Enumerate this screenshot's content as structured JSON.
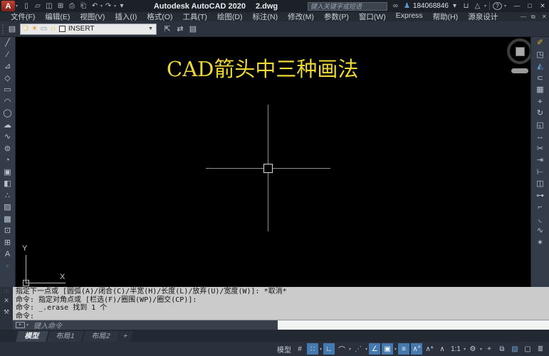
{
  "colors": {
    "accent_blue": "#4679ae",
    "heading_yellow": "#ecd836",
    "logo_red": "#b03a2e",
    "layer_icon_yellow": "#e8c520",
    "canvas_bg": "#000000",
    "command_bg": "#cbcbcb"
  },
  "glyphs": {
    "caret": "▾"
  },
  "title_bar": {
    "logo_letter": "A",
    "app_title": "Autodesk AutoCAD 2020",
    "doc_name": "2.dwg",
    "search_placeholder": "键入关键字或短语",
    "user_id": "184068846",
    "qat_icons": [
      {
        "name": "qnew-icon",
        "glyph": "▯"
      },
      {
        "name": "open-icon",
        "glyph": "▱"
      },
      {
        "name": "save-icon",
        "glyph": "◫"
      },
      {
        "name": "saveas-icon",
        "glyph": "⊞"
      },
      {
        "name": "plot-icon",
        "glyph": "⎙"
      },
      {
        "name": "print-icon",
        "glyph": "⎗"
      },
      {
        "name": "undo-icon",
        "glyph": "↶",
        "caret": true
      },
      {
        "name": "redo-icon",
        "glyph": "↷",
        "caret": true
      },
      {
        "name": "qat-menu-icon",
        "glyph": "▾"
      }
    ],
    "account_icons_left": [
      {
        "name": "search-icon",
        "glyph": "∞"
      },
      {
        "name": "sign-in-icon",
        "glyph": "♟"
      }
    ],
    "account_icons_right": [
      {
        "name": "account-caret-icon",
        "glyph": "▾"
      },
      {
        "name": "app-store-cart-icon",
        "glyph": "⊔"
      },
      {
        "name": "autodesk-app-icon",
        "glyph": "△",
        "caret": true
      }
    ],
    "help_icons": [
      {
        "name": "help-icon",
        "glyph": "?",
        "caret": true
      }
    ],
    "window_controls": [
      {
        "name": "minimize-button",
        "glyph": "—"
      },
      {
        "name": "maximize-button",
        "glyph": "□"
      },
      {
        "name": "close-button",
        "glyph": "✕"
      }
    ]
  },
  "menu_bar": {
    "items": [
      {
        "name": "menu-file",
        "label": "文件(F)"
      },
      {
        "name": "menu-edit",
        "label": "编辑(E)"
      },
      {
        "name": "menu-view",
        "label": "视图(V)"
      },
      {
        "name": "menu-insert",
        "label": "插入(I)"
      },
      {
        "name": "menu-format",
        "label": "格式(O)"
      },
      {
        "name": "menu-tools",
        "label": "工具(T)"
      },
      {
        "name": "menu-draw",
        "label": "绘图(D)"
      },
      {
        "name": "menu-dimension",
        "label": "标注(N)"
      },
      {
        "name": "menu-modify",
        "label": "修改(M)"
      },
      {
        "name": "menu-parametric",
        "label": "参数(P)"
      },
      {
        "name": "menu-window",
        "label": "窗口(W)"
      },
      {
        "name": "menu-express",
        "label": "Express"
      },
      {
        "name": "menu-help",
        "label": "帮助(H)"
      },
      {
        "name": "menu-yuanquan",
        "label": "源泉设计"
      }
    ],
    "mdi_controls": [
      {
        "name": "mdi-minimize-button",
        "glyph": "—"
      },
      {
        "name": "mdi-restore-button",
        "glyph": "⧉"
      },
      {
        "name": "mdi-close-button",
        "glyph": "✕"
      }
    ]
  },
  "layer_toolbar": {
    "layer_name": "INSERT",
    "left_icons": [
      {
        "name": "layer-properties-icon",
        "glyph": "▤"
      }
    ],
    "combo_icons": [
      {
        "name": "layer-on-icon",
        "glyph": "❍",
        "color": "#e8c520"
      },
      {
        "name": "layer-freeze-icon",
        "glyph": "☀",
        "color": "#e09a28"
      },
      {
        "name": "layer-viewport-freeze-icon",
        "glyph": "▭",
        "color": "#7d8da0"
      },
      {
        "name": "layer-unlock-icon",
        "glyph": "∩",
        "color": "#e8c520"
      },
      {
        "name": "layer-color-swatch",
        "glyph": ""
      }
    ],
    "right_icons": [
      {
        "name": "make-object-layer-current-icon",
        "glyph": "⇱"
      },
      {
        "name": "layer-previous-icon",
        "glyph": "⇄"
      },
      {
        "name": "layer-states-icon",
        "glyph": "▤"
      }
    ]
  },
  "draw_toolbar": [
    {
      "name": "line-tool-icon",
      "glyph": "╱"
    },
    {
      "name": "construction-line-tool-icon",
      "glyph": "∕"
    },
    {
      "name": "polyline-tool-icon",
      "glyph": "⊿"
    },
    {
      "name": "polygon-tool-icon",
      "glyph": "◇"
    },
    {
      "name": "rectangle-tool-icon",
      "glyph": "▭"
    },
    {
      "name": "arc-tool-icon",
      "glyph": "◠"
    },
    {
      "name": "circle-tool-icon",
      "glyph": "◯"
    },
    {
      "name": "revision-cloud-tool-icon",
      "glyph": "☁"
    },
    {
      "name": "spline-tool-icon",
      "glyph": "∿"
    },
    {
      "name": "ellipse-tool-icon",
      "glyph": "⊜"
    },
    {
      "name": "ellipse-arc-tool-icon",
      "glyph": "◔"
    },
    {
      "name": "insert-block-tool-icon",
      "glyph": "▣"
    },
    {
      "name": "make-block-tool-icon",
      "glyph": "◧"
    },
    {
      "name": "point-tool-icon",
      "glyph": "∴"
    },
    {
      "name": "hatch-tool-icon",
      "glyph": "▨"
    },
    {
      "name": "gradient-tool-icon",
      "glyph": "▩"
    },
    {
      "name": "region-tool-icon",
      "glyph": "⊡"
    },
    {
      "name": "table-tool-icon",
      "glyph": "⊞"
    },
    {
      "name": "mtext-tool-icon",
      "glyph": "A"
    },
    {
      "name": "multiple-points-tool-icon",
      "glyph": "◦",
      "color": "#5b9bd5"
    }
  ],
  "modify_toolbar": [
    {
      "name": "erase-tool-icon",
      "glyph": "✐",
      "color": "#d8b51e"
    },
    {
      "name": "copy-tool-icon",
      "glyph": "◳"
    },
    {
      "name": "mirror-tool-icon",
      "glyph": "◭",
      "color": "#5b9bd5"
    },
    {
      "name": "offset-tool-icon",
      "glyph": "⊂"
    },
    {
      "name": "array-tool-icon",
      "glyph": "▦"
    },
    {
      "name": "move-tool-icon",
      "glyph": "⌖"
    },
    {
      "name": "rotate-tool-icon",
      "glyph": "↻"
    },
    {
      "name": "scale-tool-icon",
      "glyph": "◱"
    },
    {
      "name": "stretch-tool-icon",
      "glyph": "↔"
    },
    {
      "name": "trim-tool-icon",
      "glyph": "✂"
    },
    {
      "name": "extend-tool-icon",
      "glyph": "⇥"
    },
    {
      "name": "break-at-point-tool-icon",
      "glyph": "⊢"
    },
    {
      "name": "break-tool-icon",
      "glyph": "◫"
    },
    {
      "name": "join-tool-icon",
      "glyph": "⊶"
    },
    {
      "name": "chamfer-tool-icon",
      "glyph": "⌐"
    },
    {
      "name": "fillet-tool-icon",
      "glyph": "◟"
    },
    {
      "name": "blend-curves-tool-icon",
      "glyph": "∿"
    },
    {
      "name": "explode-tool-icon",
      "glyph": "✶"
    }
  ],
  "canvas": {
    "heading": "CAD箭头中三种画法",
    "ucs_x_label": "X",
    "ucs_y_label": "Y"
  },
  "command_line": {
    "history": [
      {
        "name": "command-history-line",
        "text": "指定下一点或 [圆弧(A)/闭合(C)/半宽(H)/长度(L)/放弃(U)/宽度(W)]: *取消*"
      },
      {
        "name": "command-history-line",
        "text": "命令: 指定对角点或 [栏选(F)/圈围(WP)/圈交(CP)]:"
      },
      {
        "name": "command-history-line",
        "text": "命令: _.erase 找到 1 个"
      },
      {
        "name": "command-history-line",
        "text": "命令:"
      }
    ],
    "input_placeholder": "键入命令",
    "dock_icons": [
      {
        "name": "command-close-icon",
        "glyph": "✕"
      },
      {
        "name": "command-customize-wrench-icon",
        "glyph": "⚒"
      }
    ]
  },
  "layout_tabs": [
    {
      "name": "tab-model",
      "label": "模型",
      "on": true
    },
    {
      "name": "tab-layout1",
      "label": "布局1"
    },
    {
      "name": "tab-layout2",
      "label": "布局2"
    },
    {
      "name": "add-layout-button",
      "label": "+"
    }
  ],
  "status_bar": [
    {
      "name": "model-space-button",
      "label": "模型"
    },
    {
      "name": "grid-icon",
      "glyph": "#"
    },
    {
      "name": "snap-mode-icon",
      "glyph": "∷",
      "on": true,
      "caret": true
    },
    {
      "name": "ortho-mode-icon",
      "glyph": "∟",
      "on": true
    },
    {
      "name": "polar-tracking-icon",
      "glyph": "⌒",
      "caret": true
    },
    {
      "name": "isometric-drafting-icon",
      "glyph": "⋰",
      "caret": true
    },
    {
      "name": "object-snap-tracking-icon",
      "glyph": "∠",
      "on": true
    },
    {
      "name": "object-snap-icon",
      "glyph": "▣",
      "on": true,
      "caret": true
    },
    {
      "name": "lineweight-icon",
      "glyph": "≡",
      "on": true
    },
    {
      "name": "annotation-visibility-icon",
      "glyph": "∧°",
      "on": true
    },
    {
      "name": "annotation-autoscale-icon",
      "glyph": "∧*"
    },
    {
      "name": "annotation-scale-icon",
      "glyph": "∧"
    },
    {
      "name": "annotation-scale-value",
      "label": "1:1",
      "caret": true
    },
    {
      "name": "workspace-switching-icon",
      "glyph": "⚙",
      "caret": true
    },
    {
      "name": "isolate-objects-icon",
      "glyph": "+"
    },
    {
      "name": "quick-properties-icon",
      "glyph": "⧉"
    },
    {
      "name": "graphics-performance-icon",
      "glyph": "▧",
      "color": "#6aa5d8"
    },
    {
      "name": "clean-screen-icon",
      "glyph": "▢"
    },
    {
      "name": "customization-menu-icon",
      "glyph": "≣"
    }
  ]
}
